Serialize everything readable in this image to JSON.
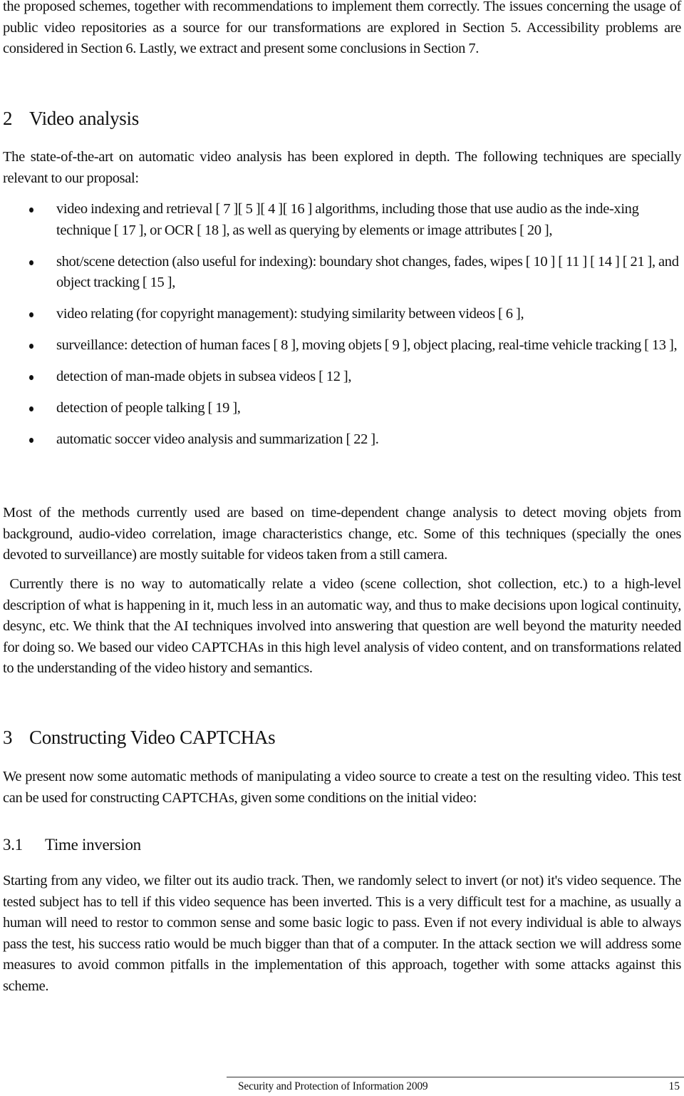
{
  "intro": {
    "text": "the proposed schemes, together with recommendations to implement them correctly. The issues concerning the usage of public video repositories as a source for our transformations are explored in Section 5. Accessibility problems are considered in Section 6. Lastly, we extract and present some conclusions in Section 7."
  },
  "section2": {
    "number": "2",
    "title": "Video analysis",
    "intro": "The state-of-the-art on automatic video analysis has been explored in depth. The following techniques are specially relevant to our proposal:",
    "bullets": [
      "video indexing and retrieval [ 7 ][ 5 ][ 4 ][ 16 ] algorithms, including those that use audio as the inde-xing technique [ 17 ], or OCR [ 18 ], as well as querying by elements or image attributes [ 20 ],",
      "shot/scene detection (also useful for indexing): boundary shot changes, fades, wipes [ 10 ] [ 11 ] [ 14 ] [ 21 ], and object tracking [ 15 ],",
      "video relating (for copyright management): studying similarity between videos [ 6 ],",
      "surveillance: detection of human faces [ 8 ], moving objets [ 9 ], object placing, real-time vehicle tracking [ 13 ],",
      "detection of man-made objets in subsea videos [ 12 ],",
      "detection of people talking [ 19 ],",
      "automatic soccer video analysis and summarization [ 22 ]."
    ],
    "para1": "Most of the methods currently used are based on time-dependent change analysis to detect moving objets from background, audio-video correlation, image characteristics change, etc. Some of this techniques (specially the ones devoted to surveillance) are mostly suitable for videos taken from a still camera.",
    "para2": " Currently there is no way to automatically relate a video (scene collection, shot collection, etc.) to a high-level description of what is happening in it, much less in an automatic way, and thus to make decisions upon logical continuity, desync, etc. We think that the AI techniques involved into answering that question are well beyond the maturity needed for doing so. We based our video CAPTCHAs in this high level analysis of video content, and on transformations related to the understanding of the video history and semantics."
  },
  "section3": {
    "number": "3",
    "title": "Constructing Video CAPTCHAs",
    "intro": "We present now some automatic methods of manipulating a video source to create a test on the resulting video. This test can be used for constructing CAPTCHAs, given some conditions on the initial video:",
    "subsection": {
      "number": "3.1",
      "title": "Time inversion",
      "text": "Starting from any video, we filter out its audio track. Then, we randomly select to invert (or not) it's video sequence. The tested subject has to tell if this video sequence has been inverted. This is a very difficult test for a machine, as usually a human will need to restor to common sense and some basic logic to pass. Even if not every individual is able to always pass the test, his success ratio would be much bigger than that of a computer. In the attack section we will address some measures to avoid common pitfalls in the implementation of this approach, together with some attacks against this scheme."
    }
  },
  "footer": {
    "title": "Security and Protection of Information 2009",
    "page_number": "15"
  }
}
